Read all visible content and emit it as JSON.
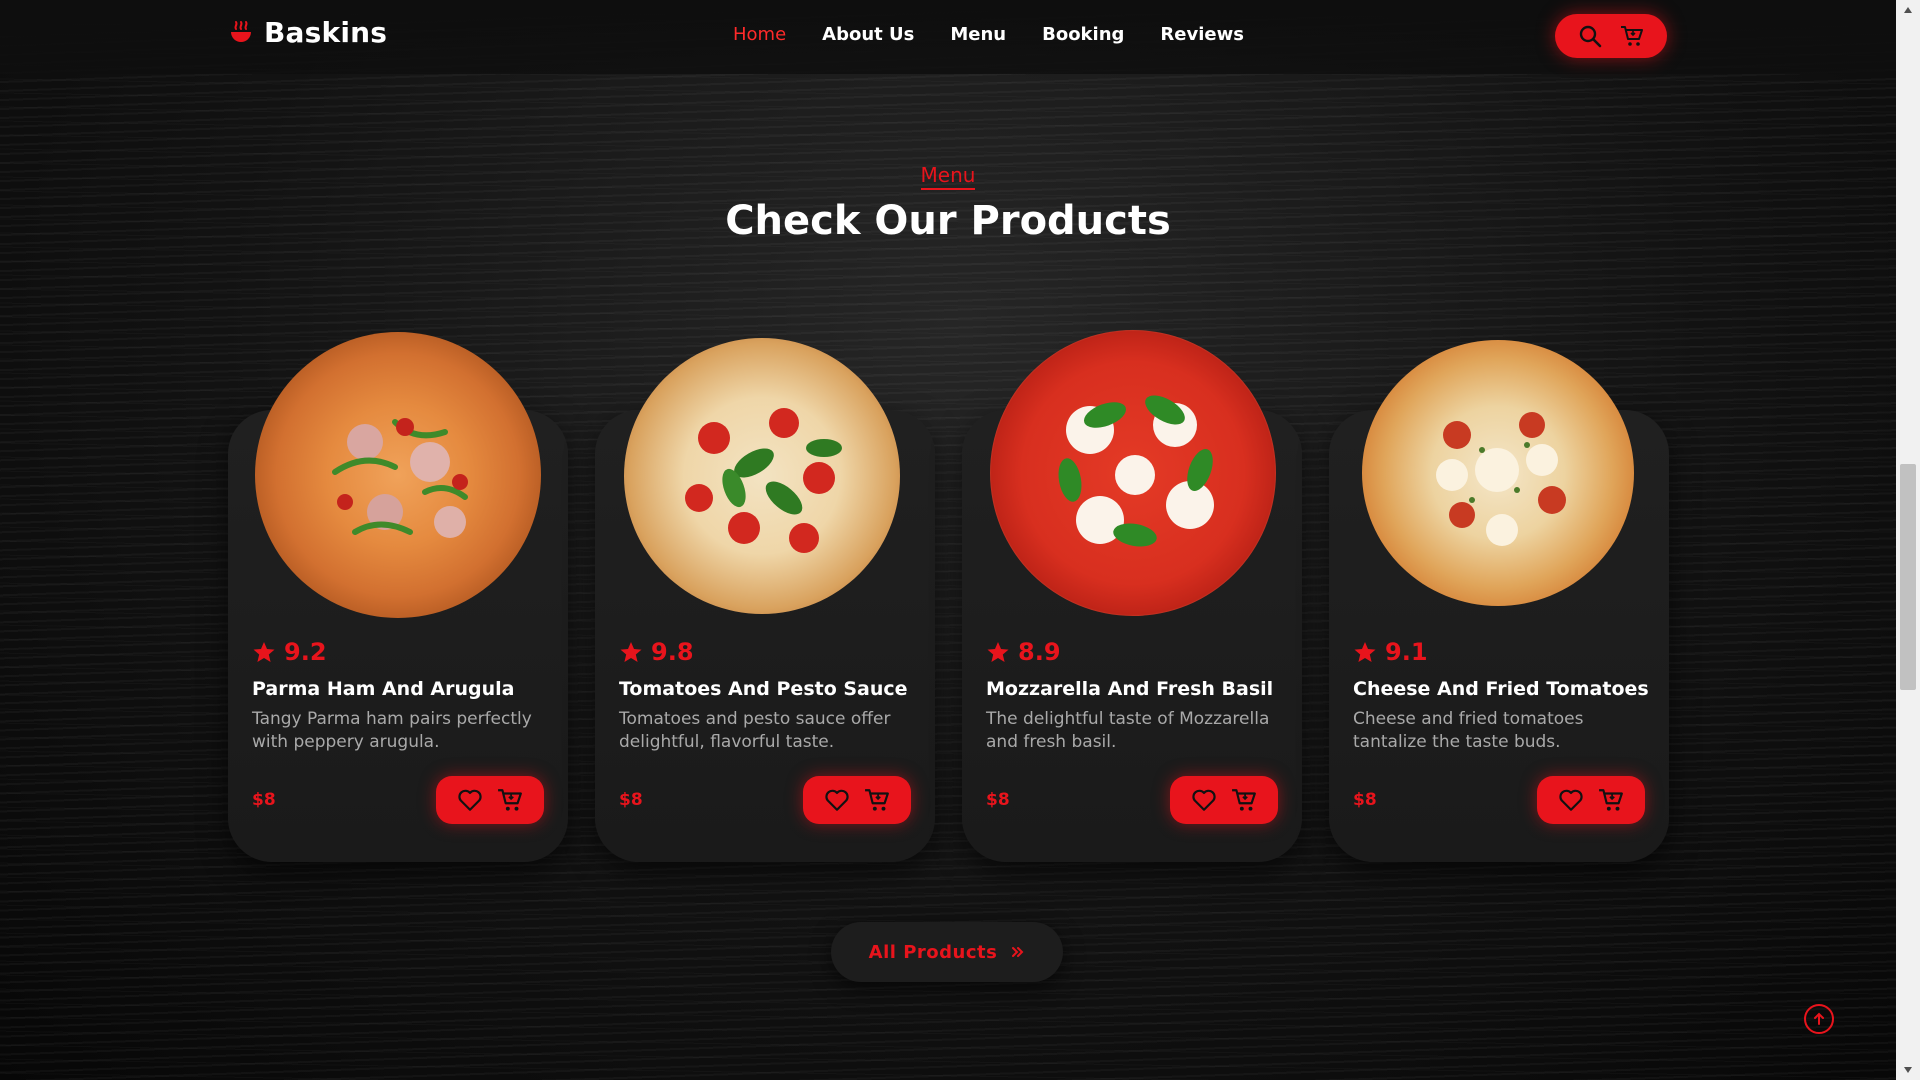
{
  "brand": {
    "name": "Baskins",
    "icon": "flame-bowl-icon"
  },
  "nav": {
    "items": [
      {
        "label": "Home",
        "active": true
      },
      {
        "label": "About Us",
        "active": false
      },
      {
        "label": "Menu",
        "active": false
      },
      {
        "label": "Booking",
        "active": false
      },
      {
        "label": "Reviews",
        "active": false
      }
    ],
    "actions": [
      "search-icon",
      "cart-icon"
    ]
  },
  "section": {
    "eyebrow": "Menu",
    "title": "Check Our Products"
  },
  "products": [
    {
      "rating": "9.2",
      "name": "Parma Ham And Arugula",
      "description": "Tangy Parma ham pairs perfectly with peppery arugula.",
      "price": "$8"
    },
    {
      "rating": "9.8",
      "name": "Tomatoes And Pesto Sauce",
      "description": "Tomatoes and pesto sauce offer delightful, flavorful taste.",
      "price": "$8"
    },
    {
      "rating": "8.9",
      "name": "Mozzarella And Fresh Basil",
      "description": "The delightful taste of Mozzarella and fresh basil.",
      "price": "$8"
    },
    {
      "rating": "9.1",
      "name": "Cheese And Fried Tomatoes",
      "description": "Cheese and fried tomatoes tantalize the taste buds.",
      "price": "$8"
    }
  ],
  "all_products": {
    "label": "All Products"
  },
  "colors": {
    "accent": "#e8141c",
    "card": "#1f1f1f",
    "background": "#0b0b0b"
  }
}
